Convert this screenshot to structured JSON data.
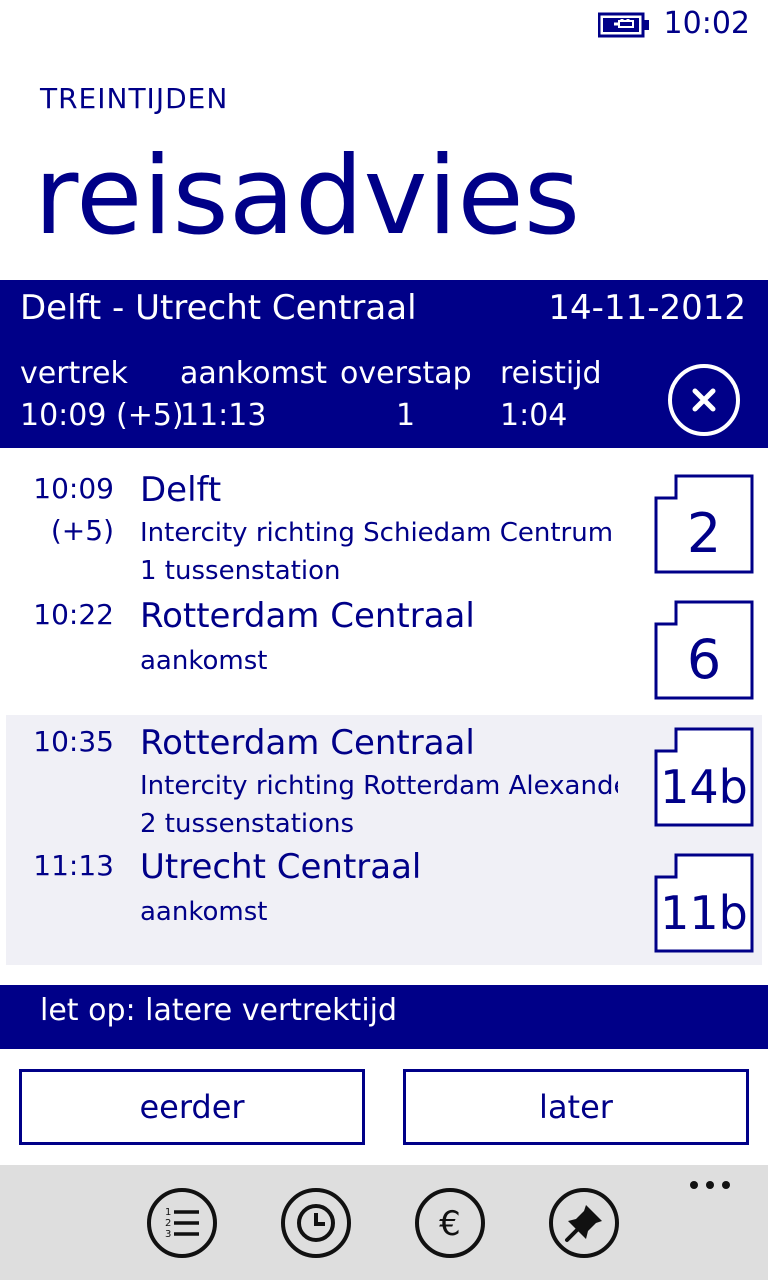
{
  "status": {
    "time": "10:02"
  },
  "header": {
    "app_name": "TREINTIJDEN",
    "title": "reisadvies"
  },
  "summary": {
    "route": "Delft - Utrecht Centraal",
    "date": "14-11-2012",
    "columns": [
      {
        "label": "vertrek",
        "value": "10:09 (+5)"
      },
      {
        "label": "aankomst",
        "value": "11:13"
      },
      {
        "label": "overstap",
        "value": "1"
      },
      {
        "label": "reistijd",
        "value": "1:04"
      }
    ]
  },
  "legs": [
    {
      "departure_time": "10:09",
      "delay": "(+5)",
      "from_station": "Delft",
      "train": "Intercity richting Schiedam Centrum",
      "stops": "1 tussenstation",
      "from_platform": "2",
      "arrival_time": "10:22",
      "to_station": "Rotterdam Centraal",
      "arrival_label": "aankomst",
      "to_platform": "6"
    },
    {
      "departure_time": "10:35",
      "from_station": "Rotterdam Centraal",
      "train": "Intercity richting Rotterdam Alexander",
      "stops": "2 tussenstations",
      "from_platform": "14b",
      "arrival_time": "11:13",
      "to_station": "Utrecht Centraal",
      "arrival_label": "aankomst",
      "to_platform": "11b"
    }
  ],
  "notice": "let op: latere vertrektijd",
  "buttons": {
    "earlier": "eerder",
    "later": "later"
  },
  "app_bar": {
    "icons": [
      "list-icon",
      "clock-icon",
      "euro-icon",
      "pin-icon"
    ]
  },
  "colors": {
    "accent": "#000088",
    "app_bar": "#dedede",
    "alt_row": "#f0f0f6"
  }
}
